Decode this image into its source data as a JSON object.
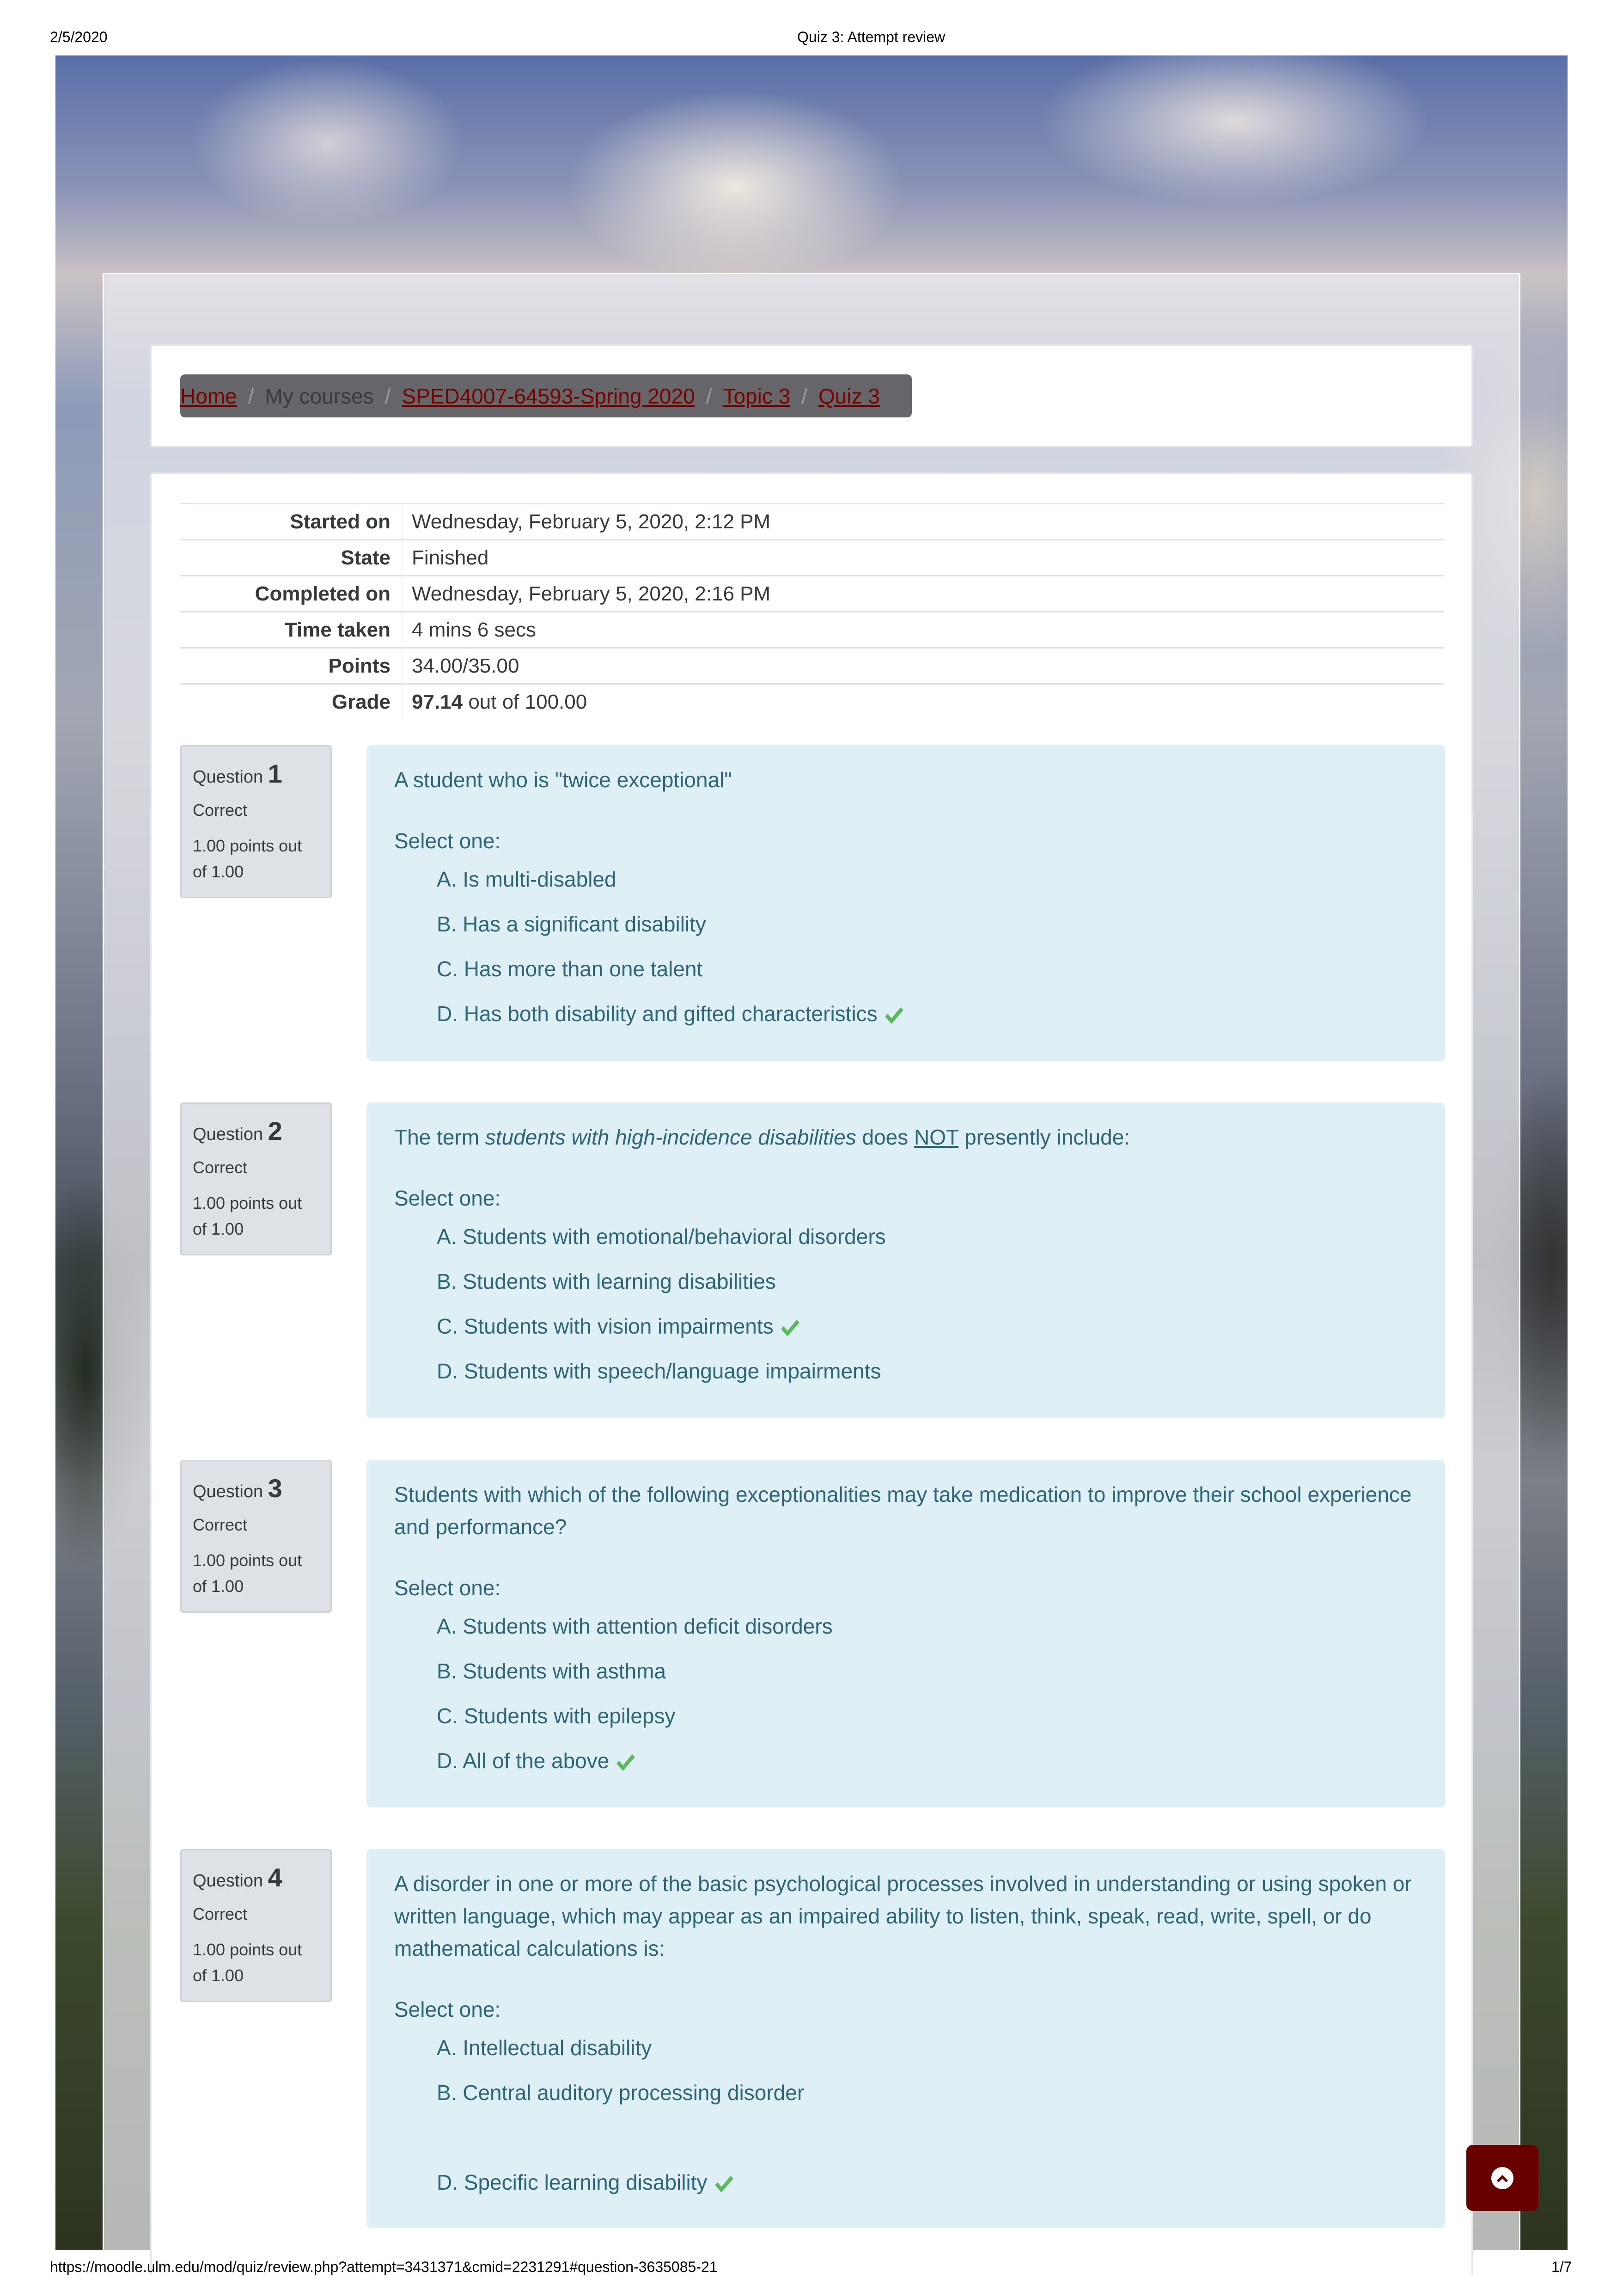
{
  "print_header": {
    "date": "2/5/2020",
    "title": "Quiz 3: Attempt review"
  },
  "print_footer": {
    "url": "https://moodle.ulm.edu/mod/quiz/review.php?attempt=3431371&cmid=2231291#question-3635085-21",
    "page": "1/7"
  },
  "breadcrumb": {
    "home": "Home",
    "my_courses": "My courses",
    "course": "SPED4007-64593-Spring 2020",
    "topic": "Topic 3",
    "quiz": "Quiz 3",
    "separator": "/"
  },
  "summary": {
    "rows": [
      {
        "label": "Started on",
        "value": "Wednesday, February 5, 2020, 2:12 PM"
      },
      {
        "label": "State",
        "value": "Finished"
      },
      {
        "label": "Completed on",
        "value": "Wednesday, February 5, 2020, 2:16 PM"
      },
      {
        "label": "Time taken",
        "value": "4 mins 6 secs"
      },
      {
        "label": "Points",
        "value": "34.00/35.00"
      }
    ],
    "grade_label": "Grade",
    "grade_value": "97.14",
    "grade_suffix": " out of 100.00"
  },
  "questions": [
    {
      "label": "Question",
      "number": "1",
      "state": "Correct",
      "grade": "1.00 points out of 1.00",
      "text": "A student who is \"twice exceptional\"",
      "prompt": "Select one:",
      "answers": [
        "A. Is multi-disabled",
        "B. Has a significant disability",
        "C. Has more than one talent",
        "D. Has both disability and gifted characteristics"
      ],
      "correct_index": 3
    },
    {
      "label": "Question",
      "number": "2",
      "state": "Correct",
      "grade": "1.00 points out of 1.00",
      "text_parts": {
        "before": "The term ",
        "italic": "students with high-incidence disabilities",
        "middle": " does ",
        "underline": "NOT",
        "after": " presently include:"
      },
      "prompt": "Select one:",
      "answers": [
        "A. Students with emotional/behavioral disorders",
        "B. Students with learning disabilities",
        "C. Students with vision impairments",
        "D. Students with speech/language impairments"
      ],
      "correct_index": 2
    },
    {
      "label": "Question",
      "number": "3",
      "state": "Correct",
      "grade": "1.00 points out of 1.00",
      "text": "Students with which of the following exceptionalities may take medication to improve their school experience and performance?",
      "prompt": "Select one:",
      "answers": [
        "A. Students with attention deficit disorders",
        "B. Students with asthma",
        "C. Students with epilepsy",
        "D. All of the above"
      ],
      "correct_index": 3
    },
    {
      "label": "Question",
      "number": "4",
      "state": "Correct",
      "grade": "1.00 points out of 1.00",
      "text": "A disorder in one or more of the basic psychological processes involved in understanding or using spoken or written language, which may appear as an impaired ability to listen, think, speak, read, write, spell, or do mathematical calculations is:",
      "prompt": "Select one:",
      "answers": [
        "A. Intellectual disability",
        "B. Central auditory processing disorder",
        "",
        "D. Specific learning disability"
      ],
      "correct_index": 3
    }
  ],
  "icons": {
    "check": "check-icon",
    "scroll_top": "chevron-circle-up-icon"
  },
  "colors": {
    "correct_check": "#5cb85c",
    "link": "#7a0000",
    "scroll_button": "#680000",
    "question_bg": "#def0f6",
    "question_text": "#2f6473"
  }
}
